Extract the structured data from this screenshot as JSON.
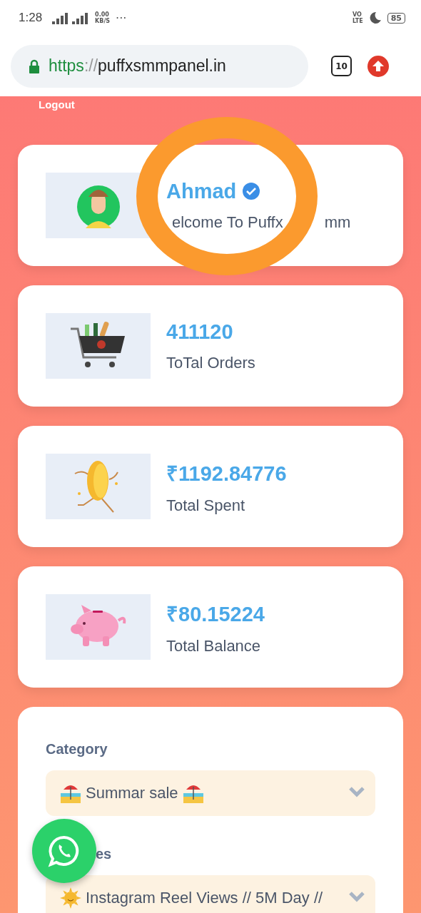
{
  "status_bar": {
    "time": "1:28",
    "net_speed": "0.00",
    "net_unit": "KB/S",
    "more": "···",
    "volte_top": "VO",
    "volte_bottom": "LTE",
    "battery": "85"
  },
  "browser": {
    "url_scheme": "https",
    "url_separator": "://",
    "url_host": "puffxsmmpanel.in",
    "tab_count": "10"
  },
  "logout": "Logout",
  "profile": {
    "name": "Ahmad",
    "verified": true,
    "welcome_visible": "elcome To Puffx",
    "welcome_tail": "mm"
  },
  "annotation": {
    "kind": "scribble",
    "color": "#fb9a2e"
  },
  "stats": [
    {
      "kind": "cart",
      "value": "411120",
      "label": "ToTal Orders"
    },
    {
      "kind": "coin",
      "value": "₹1192.84776",
      "label": "Total Spent"
    },
    {
      "kind": "piggy",
      "value": "₹80.15224",
      "label": "Total Balance"
    }
  ],
  "form": {
    "fields": [
      {
        "label": "Category",
        "kind": "beach",
        "value": "Summar sale",
        "trailing_icon": true
      },
      {
        "label": "es",
        "kind": "sun",
        "value": "Instagram Reel Views // 5M Day //"
      }
    ]
  },
  "whatsapp_button": true
}
